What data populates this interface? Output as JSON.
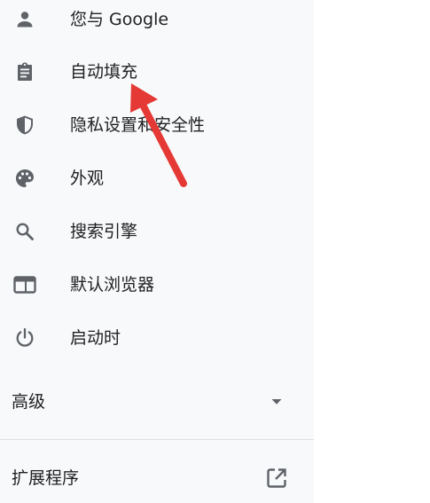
{
  "nav": {
    "items": [
      {
        "label": "您与 Google",
        "icon": "person-icon"
      },
      {
        "label": "自动填充",
        "icon": "clipboard-icon"
      },
      {
        "label": "隐私设置和安全性",
        "icon": "shield-icon"
      },
      {
        "label": "外观",
        "icon": "palette-icon"
      },
      {
        "label": "搜索引擎",
        "icon": "search-icon"
      },
      {
        "label": "默认浏览器",
        "icon": "browser-window-icon"
      },
      {
        "label": "启动时",
        "icon": "power-icon"
      }
    ]
  },
  "advanced": {
    "label": "高级",
    "icon": "dropdown-arrow-icon"
  },
  "extensions": {
    "label": "扩展程序",
    "icon": "open-in-new-icon"
  },
  "annotation": {
    "arrow_color": "#e53935"
  },
  "colors": {
    "icon": "#5f6368",
    "panel_bg": "#f8f9fa",
    "text": "#202124"
  }
}
